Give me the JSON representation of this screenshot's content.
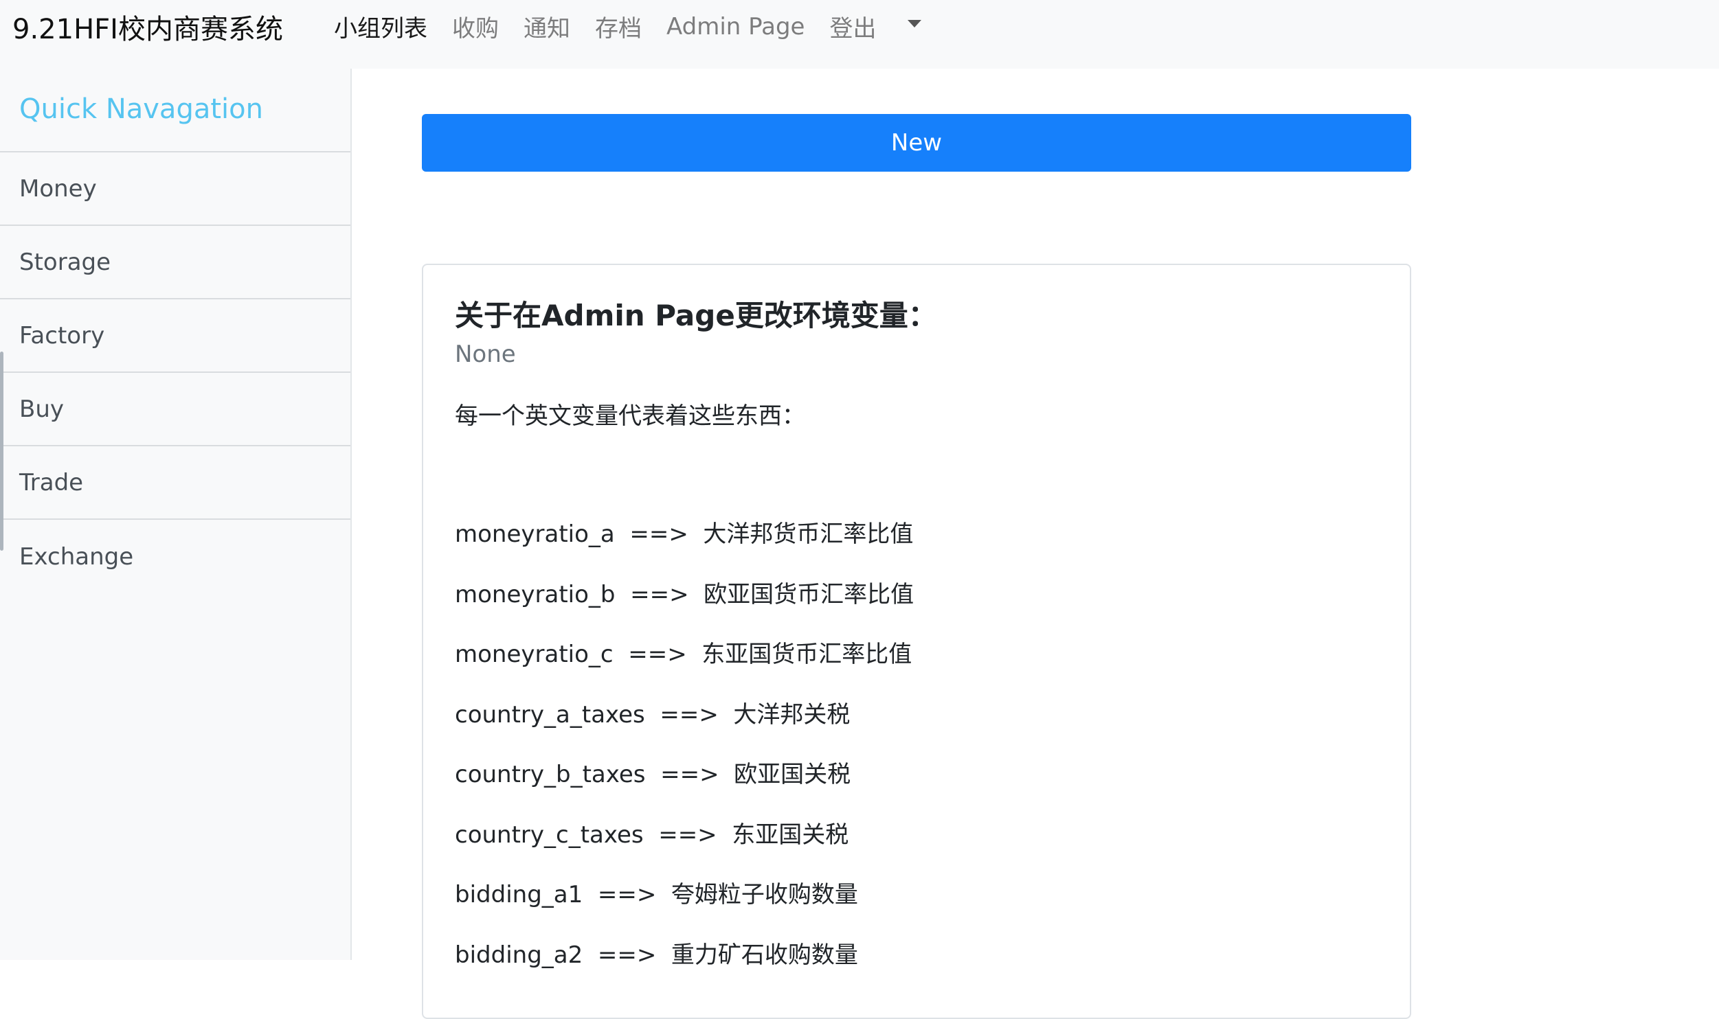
{
  "navbar": {
    "brand": "9.21HFI校内商赛系统",
    "links": [
      "小组列表",
      "收购",
      "通知",
      "存档",
      "Admin Page",
      "登出"
    ]
  },
  "sidebar": {
    "title": "Quick Navagation",
    "items": [
      "Money",
      "Storage",
      "Factory",
      "Buy",
      "Trade",
      "Exchange"
    ]
  },
  "main": {
    "new_button_label": "New",
    "card": {
      "title": "关于在Admin Page更改环境变量：",
      "subtitle": "None",
      "intro": "每一个英文变量代表着这些东西：",
      "lines": [
        "moneyratio_a  ==>  大洋邦货币汇率比值",
        "moneyratio_b  ==>  欧亚国货币汇率比值",
        "moneyratio_c  ==>  东亚国货币汇率比值",
        "country_a_taxes  ==>  大洋邦关税",
        "country_b_taxes  ==>  欧亚国关税",
        "country_c_taxes  ==>  东亚国关税",
        "bidding_a1  ==>  夸姆粒子收购数量",
        "bidding_a2  ==>  重力矿石收购数量"
      ]
    }
  },
  "colors": {
    "primary": "#1680fb",
    "sidebar_title": "#56c4f0",
    "navbar_bg": "#f8f9fa"
  },
  "icons": {
    "dropdown": "chevron-down-icon"
  }
}
